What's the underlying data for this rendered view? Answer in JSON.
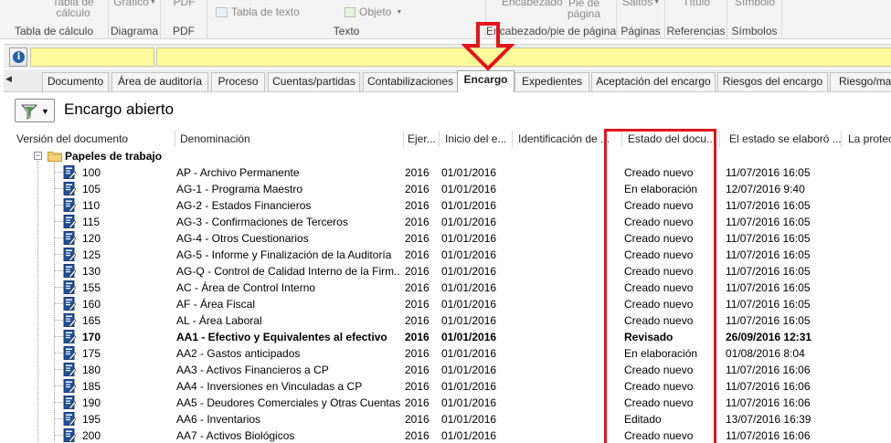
{
  "ribbon": {
    "groups": [
      {
        "label": "Tabla de cálculo",
        "items": [
          "Tabla de cálculo"
        ]
      },
      {
        "label": "Diagrama",
        "items": [
          "Gráfico"
        ]
      },
      {
        "label": "PDF",
        "items": [
          "PDF"
        ]
      },
      {
        "label": "Texto",
        "items": [
          "Tabla de texto",
          "Objeto"
        ]
      },
      {
        "label": "Encabezado/pie de página",
        "items": [
          "Encabezado",
          "Pie de página"
        ]
      },
      {
        "label": "Páginas",
        "items": [
          "Saltos"
        ]
      },
      {
        "label": "Referencias",
        "items": [
          "Título"
        ]
      },
      {
        "label": "Símbolos",
        "items": [
          "Símbolo"
        ]
      }
    ]
  },
  "tabs": [
    "Documento",
    "Área de auditoría",
    "Proceso",
    "Cuentas/partidas",
    "Contabilizaciones",
    "Encargo",
    "Expedientes",
    "Aceptación del encargo",
    "Riesgos del encargo",
    "Riesgo/mat"
  ],
  "active_tab": "Encargo",
  "view_title": "Encargo abierto",
  "columns": [
    "Versión del documento",
    "Denominación",
    "Ejer...",
    "Inicio del e...",
    "Identificación de ...",
    "Estado del docu...",
    "El estado se elaboró ...",
    "La protec"
  ],
  "tree_root": "Papeles de trabajo",
  "rows": [
    {
      "version": "100",
      "name": "AP - Archivo Permanente",
      "year": "2016",
      "start": "01/01/2016",
      "id": "",
      "status": "Creado nuevo",
      "date": "11/07/2016 16:05",
      "bold": false
    },
    {
      "version": "105",
      "name": "AG-1 - Programa Maestro",
      "year": "2016",
      "start": "01/01/2016",
      "id": "",
      "status": "En elaboración",
      "date": "12/07/2016 9:40",
      "bold": false
    },
    {
      "version": "110",
      "name": "AG-2 - Estados Financieros",
      "year": "2016",
      "start": "01/01/2016",
      "id": "",
      "status": "Creado nuevo",
      "date": "11/07/2016 16:05",
      "bold": false
    },
    {
      "version": "115",
      "name": "AG-3 - Confirmaciones de Terceros",
      "year": "2016",
      "start": "01/01/2016",
      "id": "",
      "status": "Creado nuevo",
      "date": "11/07/2016 16:05",
      "bold": false
    },
    {
      "version": "120",
      "name": "AG-4 - Otros Cuestionarios",
      "year": "2016",
      "start": "01/01/2016",
      "id": "",
      "status": "Creado nuevo",
      "date": "11/07/2016 16:05",
      "bold": false
    },
    {
      "version": "125",
      "name": "AG-5 - Informe y Finalización de la Auditoría",
      "year": "2016",
      "start": "01/01/2016",
      "id": "",
      "status": "Creado nuevo",
      "date": "11/07/2016 16:05",
      "bold": false
    },
    {
      "version": "130",
      "name": "AG-Q - Control de Calidad Interno de la Firm...",
      "year": "2016",
      "start": "01/01/2016",
      "id": "",
      "status": "Creado nuevo",
      "date": "11/07/2016 16:05",
      "bold": false
    },
    {
      "version": "155",
      "name": "AC - Área de Control Interno",
      "year": "2016",
      "start": "01/01/2016",
      "id": "",
      "status": "Creado nuevo",
      "date": "11/07/2016 16:05",
      "bold": false
    },
    {
      "version": "160",
      "name": "AF - Área Fiscal",
      "year": "2016",
      "start": "01/01/2016",
      "id": "",
      "status": "Creado nuevo",
      "date": "11/07/2016 16:05",
      "bold": false
    },
    {
      "version": "165",
      "name": "AL - Área Laboral",
      "year": "2016",
      "start": "01/01/2016",
      "id": "",
      "status": "Creado nuevo",
      "date": "11/07/2016 16:05",
      "bold": false
    },
    {
      "version": "170",
      "name": "AA1 - Efectivo y Equivalentes al efectivo",
      "year": "2016",
      "start": "01/01/2016",
      "id": "",
      "status": "Revisado",
      "date": "26/09/2016 12:31",
      "bold": true
    },
    {
      "version": "175",
      "name": "AA2 - Gastos anticipados",
      "year": "2016",
      "start": "01/01/2016",
      "id": "",
      "status": "En elaboración",
      "date": "01/08/2016 8:04",
      "bold": false
    },
    {
      "version": "180",
      "name": "AA3 - Activos Financieros a CP",
      "year": "2016",
      "start": "01/01/2016",
      "id": "",
      "status": "Creado nuevo",
      "date": "11/07/2016 16:06",
      "bold": false
    },
    {
      "version": "185",
      "name": "AA4 - Inversiones en Vinculadas a CP",
      "year": "2016",
      "start": "01/01/2016",
      "id": "",
      "status": "Creado nuevo",
      "date": "11/07/2016 16:06",
      "bold": false
    },
    {
      "version": "190",
      "name": "AA5 - Deudores Comerciales y Otras Cuentas...",
      "year": "2016",
      "start": "01/01/2016",
      "id": "",
      "status": "Creado nuevo",
      "date": "11/07/2016 16:06",
      "bold": false
    },
    {
      "version": "195",
      "name": "AA6 - Inventarios",
      "year": "2016",
      "start": "01/01/2016",
      "id": "",
      "status": "Editado",
      "date": "13/07/2016 16:39",
      "bold": false
    },
    {
      "version": "200",
      "name": "AA7 - Activos Biológicos",
      "year": "2016",
      "start": "01/01/2016",
      "id": "",
      "status": "Creado nuevo",
      "date": "11/07/2016 16:06",
      "bold": false
    }
  ]
}
